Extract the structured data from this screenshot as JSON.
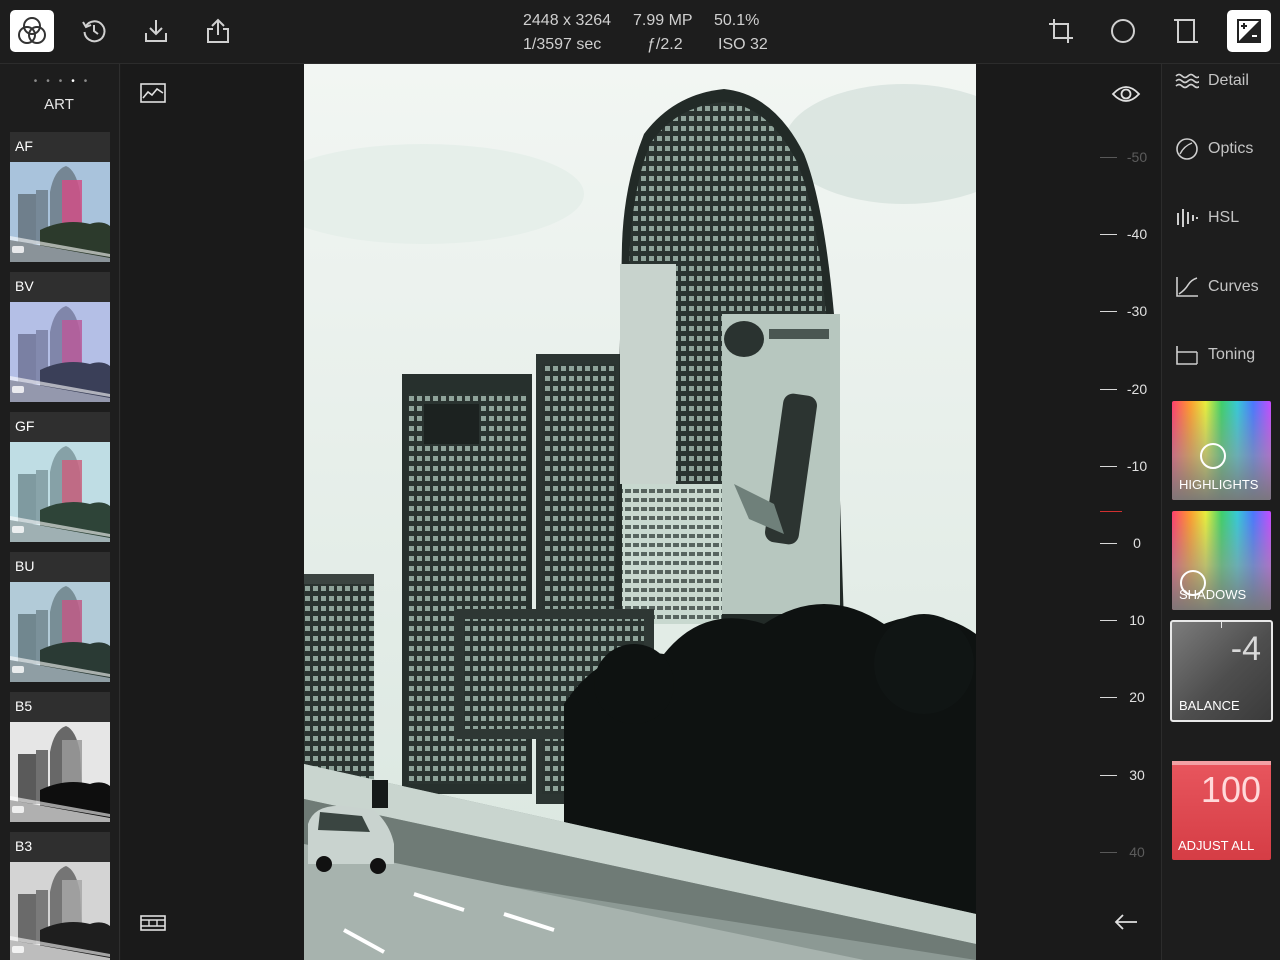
{
  "toolbar": {
    "icons": [
      "filters-icon",
      "history-icon",
      "download-icon",
      "share-icon",
      "crop-icon",
      "vignette-icon",
      "frame-icon",
      "compare-icon"
    ]
  },
  "image_info": {
    "resolution": "2448 x 3264",
    "megapixels": "7.99 MP",
    "zoom": "50.1%",
    "shutter": "1/3597 sec",
    "aperture": "ƒ/2.2",
    "iso": "ISO 32"
  },
  "filter_strip": {
    "category": "ART",
    "page_dots": 5,
    "active_dot": 4,
    "filters": [
      {
        "name": "AF"
      },
      {
        "name": "BV"
      },
      {
        "name": "GF"
      },
      {
        "name": "BU"
      },
      {
        "name": "B5"
      },
      {
        "name": "B3"
      }
    ]
  },
  "ruler": {
    "labels": [
      "-50",
      "-40",
      "-30",
      "-20",
      "-10",
      "0",
      "10",
      "20",
      "30",
      "40"
    ],
    "current": -4
  },
  "right_panel": {
    "tools": [
      {
        "id": "detail",
        "label": "Detail"
      },
      {
        "id": "optics",
        "label": "Optics"
      },
      {
        "id": "hsl",
        "label": "HSL"
      },
      {
        "id": "curves",
        "label": "Curves"
      },
      {
        "id": "toning",
        "label": "Toning"
      }
    ],
    "highlights_label": "HIGHLIGHTS",
    "shadows_label": "SHADOWS",
    "balance_label": "BALANCE",
    "balance_value": "-4",
    "adjust_all_label": "ADJUST ALL",
    "adjust_all_value": "100"
  },
  "colors": {
    "accent_red": "#d53d45",
    "active_tick": "#d13030",
    "background": "#1c1c1c"
  }
}
